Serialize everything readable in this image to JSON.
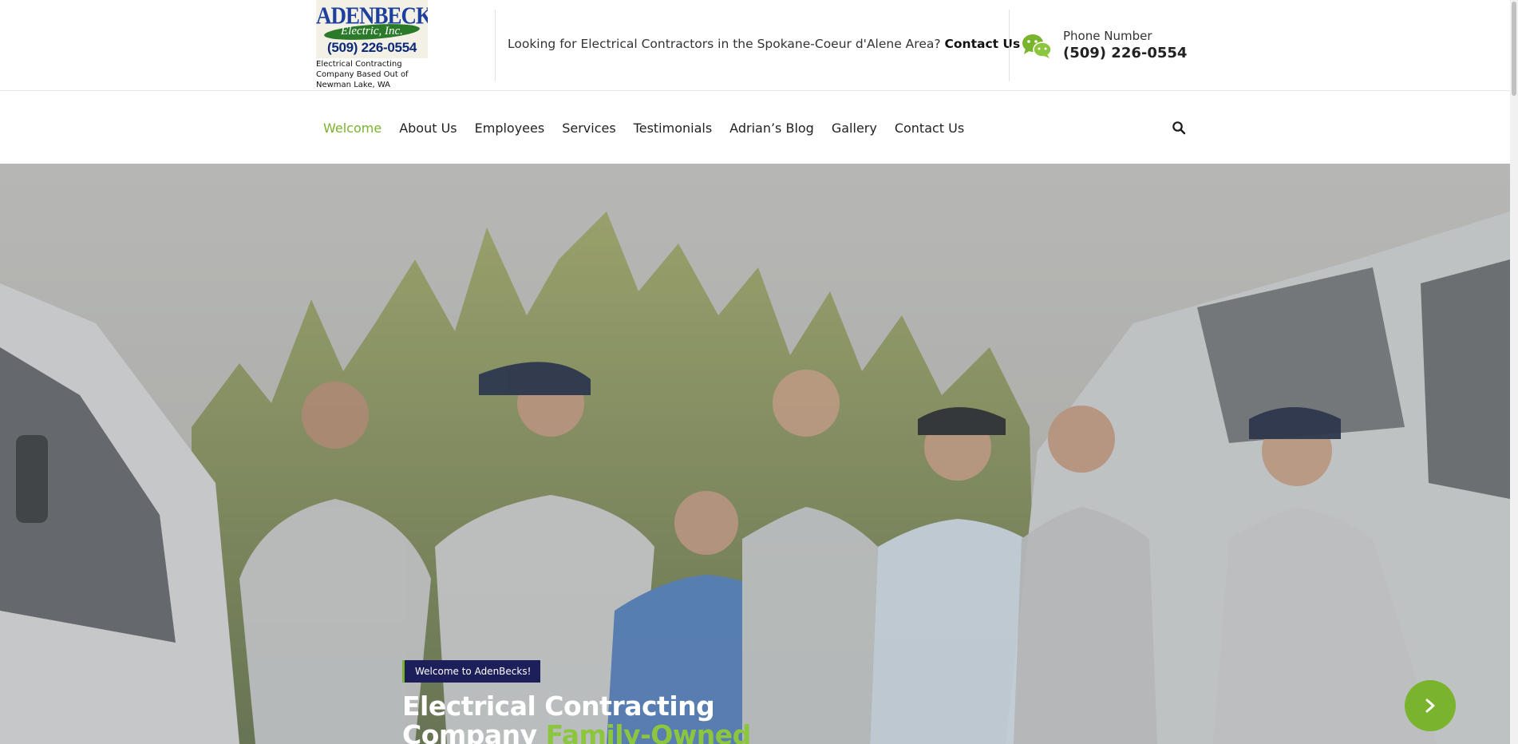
{
  "header": {
    "logo": {
      "name": "ADENBECKS",
      "script": "Electric, Inc.",
      "phone": "(509) 226-0554",
      "tagline": "Electrical Contracting Company Based Out of Newman Lake, WA"
    },
    "promo_text": "Looking for Electrical Contractors in the Spokane-Coeur d'Alene Area?",
    "promo_link": "Contact Us",
    "phone_label": "Phone Number",
    "phone_number": "(509) 226-0554",
    "phone_icon": "chat-bubbles-icon"
  },
  "nav": {
    "items": [
      {
        "label": "Welcome",
        "active": true
      },
      {
        "label": "About Us",
        "active": false
      },
      {
        "label": "Employees",
        "active": false
      },
      {
        "label": "Services",
        "active": false
      },
      {
        "label": "Testimonials",
        "active": false
      },
      {
        "label": "Adrian’s Blog",
        "active": false
      },
      {
        "label": "Gallery",
        "active": false
      },
      {
        "label": "Contact Us",
        "active": false
      }
    ],
    "search_icon": "search-icon"
  },
  "hero": {
    "badge": "Welcome to AdenBecks!",
    "title_line1": "Electrical Contracting",
    "title_line2_plain": "Company",
    "title_line2_accent": "Family-Owned",
    "next_icon": "chevron-right-icon"
  },
  "colors": {
    "accent": "#7ab32e",
    "badge_bg": "#1c1f5a",
    "logo_blue": "#1d3f9e"
  }
}
